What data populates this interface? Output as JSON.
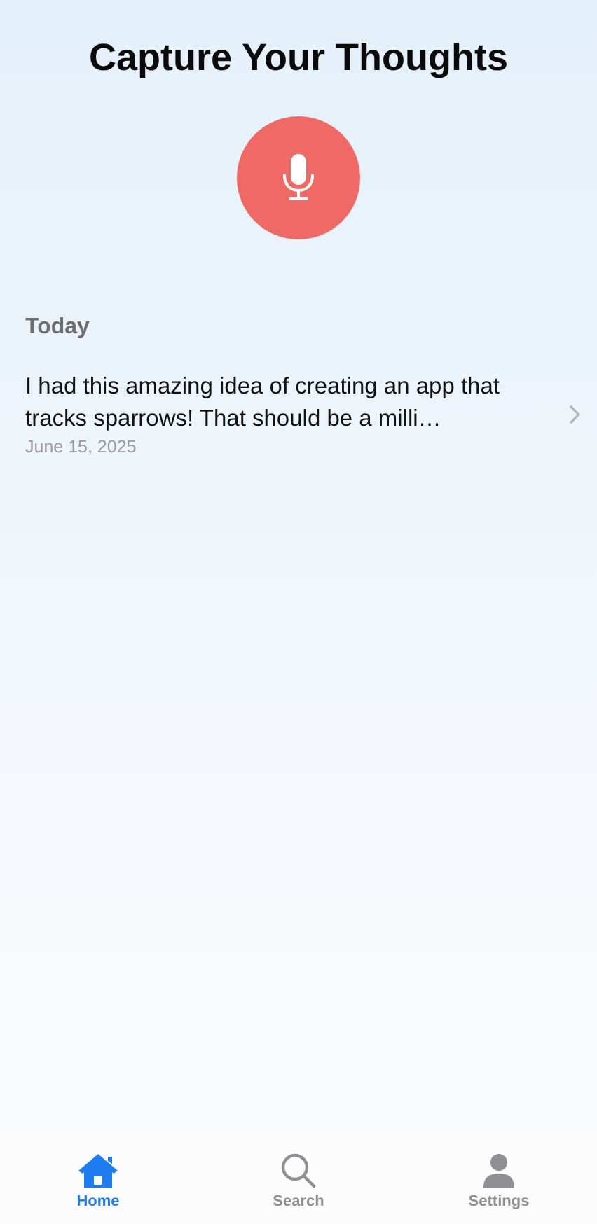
{
  "title": "Capture Your Thoughts",
  "sections": [
    {
      "heading": "Today",
      "notes": [
        {
          "text": "I had this amazing idea of creating an app that tracks sparrows! That should be a milli…",
          "date": "June 15, 2025"
        }
      ]
    }
  ],
  "tabs": [
    {
      "label": "Home",
      "kind": "home",
      "selected": true
    },
    {
      "label": "Search",
      "kind": "search",
      "selected": false
    },
    {
      "label": "Settings",
      "kind": "person",
      "selected": false
    }
  ]
}
